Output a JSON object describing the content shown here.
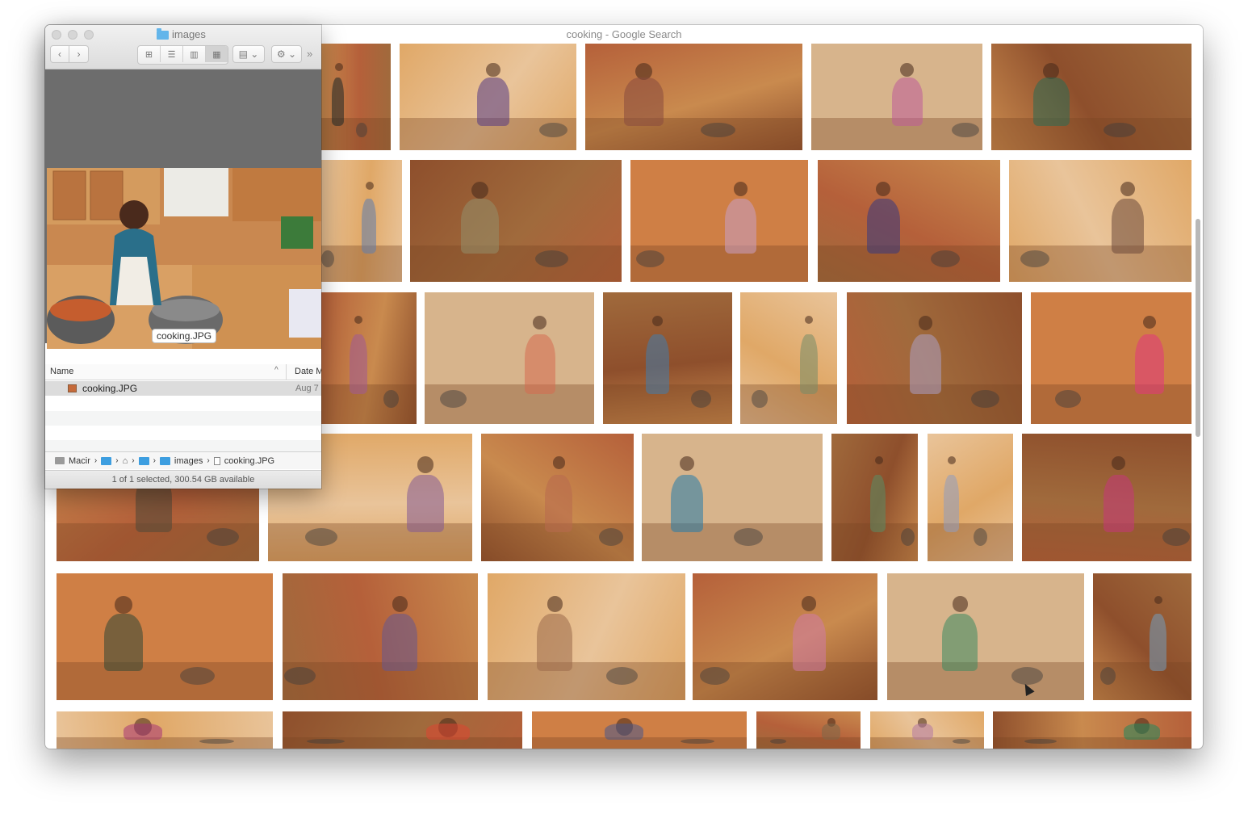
{
  "browser": {
    "title": "cooking - Google Search",
    "palette": [
      "#c98a4e",
      "#e0a867",
      "#b5603a",
      "#d7b48c",
      "#a06a3c",
      "#e9c49a",
      "#8e4f2c",
      "#cf7f45"
    ]
  },
  "finder": {
    "title": "images",
    "toolbar": {
      "back_icon": "‹",
      "forward_icon": "›",
      "icon_view": "⊞",
      "list_view": "☰",
      "column_view": "▥",
      "gallery_view": "▦",
      "arrange": "▤ ⌄",
      "action": "⚙ ⌄",
      "more": "»"
    },
    "preview": {
      "label": "cooking.JPG"
    },
    "columns": {
      "name": "Name",
      "date": "Date M"
    },
    "files": [
      {
        "name": "cooking.JPG",
        "date": "Aug 7"
      }
    ],
    "path": [
      {
        "type": "disk",
        "label": "Macir"
      },
      {
        "type": "folder",
        "label": ""
      },
      {
        "type": "home",
        "label": ""
      },
      {
        "type": "folder",
        "label": ""
      },
      {
        "type": "folder",
        "label": "images"
      },
      {
        "type": "file",
        "label": "cooking.JPG"
      }
    ],
    "status": "1 of 1 selected, 300.54 GB available"
  }
}
